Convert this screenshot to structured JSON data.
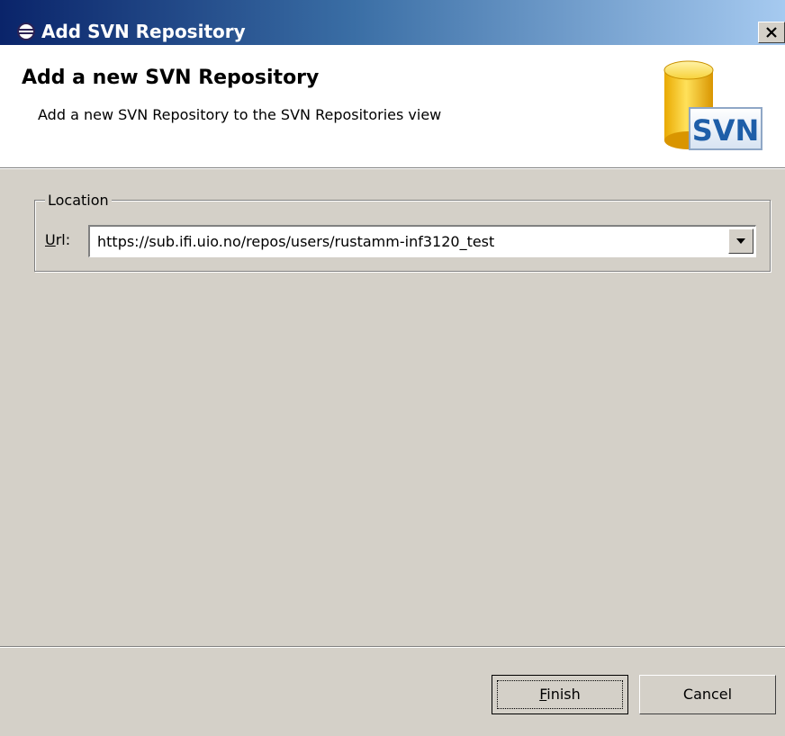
{
  "window": {
    "title": "Add SVN Repository",
    "close_glyph": "✕",
    "icon": "eclipse-icon"
  },
  "header": {
    "title": "Add a new SVN Repository",
    "description": "Add a new SVN Repository to the SVN Repositories view",
    "logo_text": "SVN"
  },
  "location_group": {
    "legend": "Location",
    "url_label_mnemonic": "U",
    "url_label_rest": "rl:",
    "url_value": "https://sub.ifi.uio.no/repos/users/rustamm-inf3120_test"
  },
  "buttons": {
    "finish_mnemonic": "F",
    "finish_rest": "inish",
    "cancel": "Cancel"
  },
  "colors": {
    "titlebar_start": "#0a246a",
    "titlebar_end": "#a6caf0",
    "dialog_bg": "#d4d0c8",
    "header_bg": "#ffffff",
    "svn_blue": "#1e5ea8",
    "cylinder_yellow": "#f2c200"
  }
}
